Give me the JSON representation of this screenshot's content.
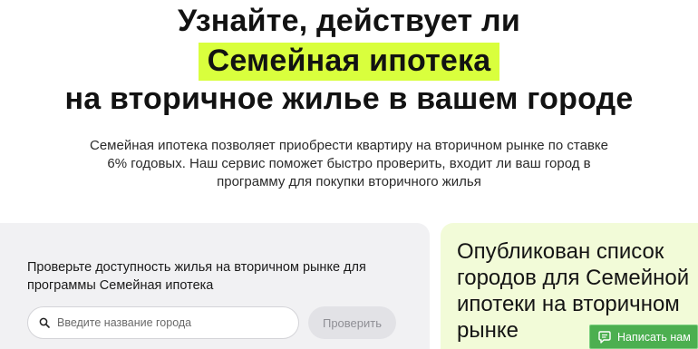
{
  "hero": {
    "line1": "Узнайте, действует ли",
    "highlight": "Семейная ипотека",
    "line3": "на вторичное жилье в вашем городе"
  },
  "lead": "Семейная ипотека позволяет приобрести квартиру на вторичном рынке по ставке 6% годовых. Наш сервис поможет быстро проверить, входит ли ваш город в программу для покупки вторичного жилья",
  "check": {
    "title": "Проверьте доступность жилья на вторичном рынке для программы Семейная ипотека",
    "search_placeholder": "Введите название города",
    "search_icon": "search-icon",
    "button_label": "Проверить"
  },
  "news": {
    "title": "Опубликован список городов для Семейной ипотеки на вторичном рынке"
  },
  "chat": {
    "label": "Написать нам",
    "icon": "chat-icon"
  },
  "colors": {
    "highlight": "#d9ff3d",
    "panel_gray": "#f1f1f3",
    "panel_green": "#f2fbd8",
    "chat_green": "#4caf50"
  }
}
